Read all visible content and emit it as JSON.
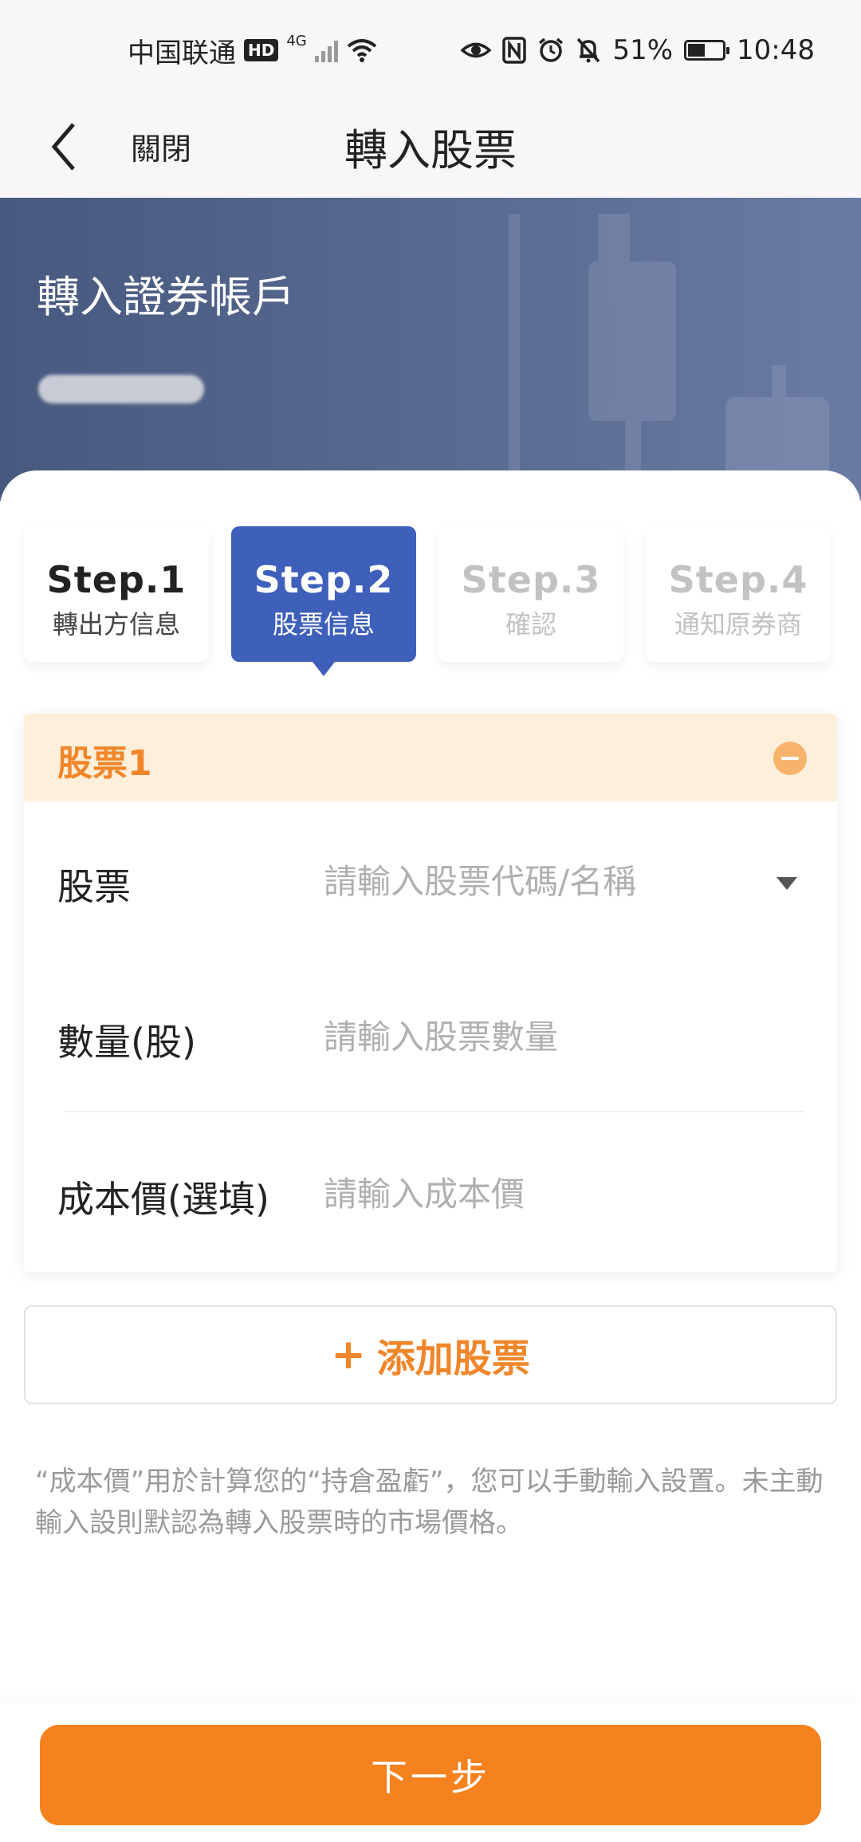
{
  "status_bar": {
    "carrier": "中国联通",
    "hd": "HD",
    "network": "4G",
    "battery_percent": "51%",
    "battery_level": 0.51,
    "time": "10:48",
    "icons": [
      "eye-icon",
      "nfc-icon",
      "alarm-icon",
      "mute-icon"
    ]
  },
  "nav": {
    "close_label": "關閉",
    "title": "轉入股票"
  },
  "banner": {
    "title": "轉入證券帳戶"
  },
  "steps": [
    {
      "num": "Step.1",
      "label": "轉出方信息",
      "state": "done"
    },
    {
      "num": "Step.2",
      "label": "股票信息",
      "state": "active"
    },
    {
      "num": "Step.3",
      "label": "確認",
      "state": "todo"
    },
    {
      "num": "Step.4",
      "label": "通知原券商",
      "state": "todo"
    }
  ],
  "stock_card": {
    "title": "股票1",
    "fields": {
      "stock": {
        "label": "股票",
        "placeholder": "請輸入股票代碼/名稱"
      },
      "quantity": {
        "label": "數量(股)",
        "placeholder": "請輸入股票數量"
      },
      "cost": {
        "label": "成本價(選填)",
        "placeholder": "請輸入成本價"
      }
    }
  },
  "add_stock": {
    "plus": "+",
    "label": "添加股票"
  },
  "note": "“成本價”用於計算您的“持倉盈虧”，您可以手動輸入設置。未主動輸入設則默認為轉入股票時的市場價格。",
  "next_button": "下一步",
  "colors": {
    "accent": "#f5821f",
    "step_active": "#3e5fba",
    "banner": "#4f6088",
    "card_header": "#fdefd9"
  }
}
